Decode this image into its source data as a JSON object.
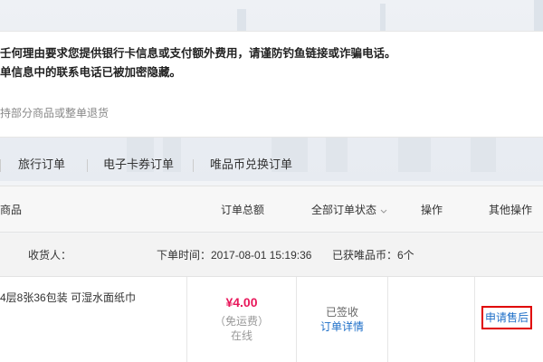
{
  "notice": {
    "line1": "壬何理由要求您提供银行卡信息或支付额外费用，请谨防钓鱼链接或诈骗电话。",
    "line2": "单信息中的联系电话已被加密隐藏。",
    "link": "持部分商品或整单退货"
  },
  "tabs": [
    {
      "label": "旅行订单"
    },
    {
      "label": "电子卡券订单"
    },
    {
      "label": "唯品币兑换订单"
    }
  ],
  "table_header": {
    "product": "商品",
    "total": "订单总额",
    "status_filter": "全部订单状态",
    "action": "操作",
    "other_action": "其他操作"
  },
  "order": {
    "recipient_label": "收货人：",
    "order_time": "下单时间：2017-08-01 15:19:36",
    "coins": "已获唯品币：6个",
    "product_name": "4层8张36包装 可湿水面纸巾",
    "price": "¥4.00",
    "shipping": "（免运费）",
    "payment": "在线",
    "status": "已签收",
    "detail_link": "订单详情",
    "aftersale": "申请售后"
  },
  "colors": {
    "price": "#e8185b",
    "link": "#1e6fc8",
    "highlight_border": "#e00000"
  }
}
